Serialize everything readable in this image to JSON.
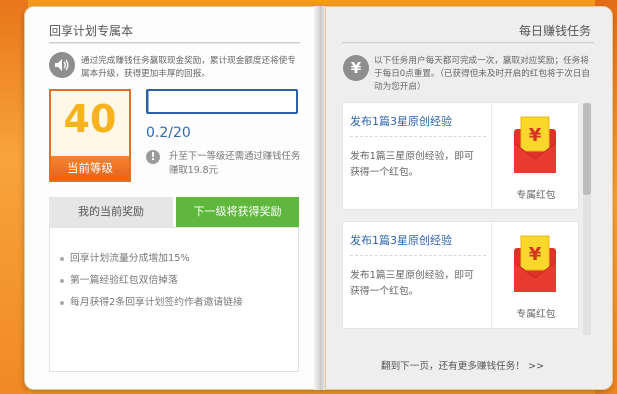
{
  "left_page": {
    "title": "回享计划专属本",
    "intro": "通过完成赚钱任务赢取现金奖励，累计现金额度还将使专属本升级，获得更加丰厚的回报。",
    "level": {
      "number": "40",
      "label": "当前等级"
    },
    "progress": {
      "text": "0.2/20",
      "fraction": 0.01
    },
    "upgrade_note": "升至下一等级还需通过赚钱任务赚取19.8元",
    "tabs": [
      {
        "label": "我的当前奖励"
      },
      {
        "label": "下一级将获得奖励"
      }
    ],
    "rewards": [
      "回享计划流量分成增加15%",
      "第一篇经验红包双倍掉落",
      "每月获得2条回享计划签约作者邀请链接"
    ]
  },
  "right_page": {
    "title": "每日赚钱任务",
    "intro": "以下任务用户每天都可完成一次，赢取对应奖励；任务将于每日0点重置。（已获得但未及时开启的红包将于次日自动为您开启）",
    "tasks": [
      {
        "title": "发布1篇3星原创经验",
        "desc": "发布1篇三星原创经验，即可获得一个红包。",
        "reward_label": "专属红包"
      },
      {
        "title": "发布1篇3星原创经验",
        "desc": "发布1篇三星原创经验，即可获得一个红包。",
        "reward_label": "专属红包"
      }
    ],
    "footer": "翻到下一页，还有更多赚钱任务！ >>"
  },
  "icons": {
    "speaker": "speaker-icon",
    "yen": "yen-icon",
    "info": "exclamation-icon",
    "envelope": "red-envelope-icon"
  },
  "colors": {
    "accent_orange": "#f59a1e",
    "level_orange": "#e86f1d",
    "tab_green": "#5fb73d",
    "link_blue": "#2d63ad",
    "envelope_red": "#e0322a",
    "envelope_gold": "#f9d72d"
  }
}
